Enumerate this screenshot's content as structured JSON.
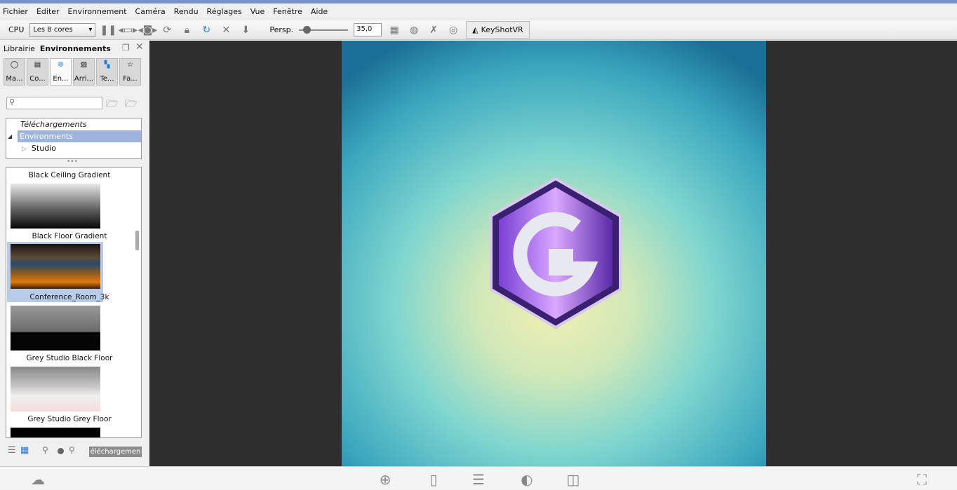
{
  "menu": [
    "Fichier",
    "Editer",
    "Environnement",
    "Caméra",
    "Rendu",
    "Réglages",
    "Vue",
    "Fenêtre",
    "Aide"
  ],
  "toolbar": {
    "cpu_label": "CPU",
    "cores": "Les 8 cores",
    "persp_label": "Persp.",
    "persp_value": "35,0",
    "vr_label": "KeyShotVR",
    "persp_slider_fraction": 0.15
  },
  "panel": {
    "library_label": "Librairie",
    "title": "Environnements",
    "tabs": [
      "Ma...",
      "Co...",
      "En...",
      "Arri...",
      "Te...",
      "Fa..."
    ],
    "tree": {
      "downloads": "Téléchargements",
      "environments": "Environments",
      "studio": "Studio"
    },
    "items": [
      "Black Ceiling Gradient",
      "Black Floor Gradient",
      "Conference_Room_3k",
      "Grey Studio Black Floor",
      "Grey Studio Grey Floor"
    ],
    "download_button": "éléchargemen"
  },
  "colors": {
    "accent": "#1a7de0",
    "selection": "#9fb4dd"
  }
}
